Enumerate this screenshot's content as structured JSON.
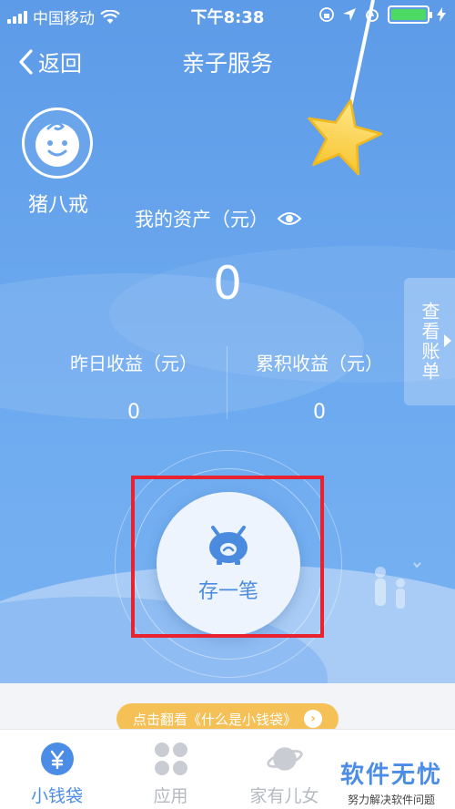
{
  "status_bar": {
    "carrier": "中国移动",
    "time": "下午8:38"
  },
  "nav": {
    "back_label": "返回",
    "title": "亲子服务"
  },
  "profile": {
    "name": "猪八戒"
  },
  "assets": {
    "label": "我的资产（元）",
    "value": "0"
  },
  "stats": [
    {
      "label": "昨日收益（元）",
      "value": "0"
    },
    {
      "label": "累积收益（元）",
      "value": "0"
    }
  ],
  "side_tab": {
    "label": "查看账单"
  },
  "deposit": {
    "label": "存一笔"
  },
  "promo": {
    "text": "点击翻看《什么是小钱袋》"
  },
  "tabbar": {
    "items": [
      {
        "label": "小钱袋",
        "icon": "yen-coin-icon",
        "active": true
      },
      {
        "label": "应用",
        "icon": "clover-grid-icon",
        "active": false
      },
      {
        "label": "家有儿女",
        "icon": "planet-icon",
        "active": false
      }
    ]
  },
  "watermark": {
    "title": "软件无忧",
    "subtitle": "努力解决软件问题"
  },
  "colors": {
    "primary_blue": "#5d9be8",
    "tab_active": "#4b8de6",
    "highlight_red": "#e8222e",
    "promo_gold": "#f5c056",
    "battery_green": "#4cd964"
  }
}
